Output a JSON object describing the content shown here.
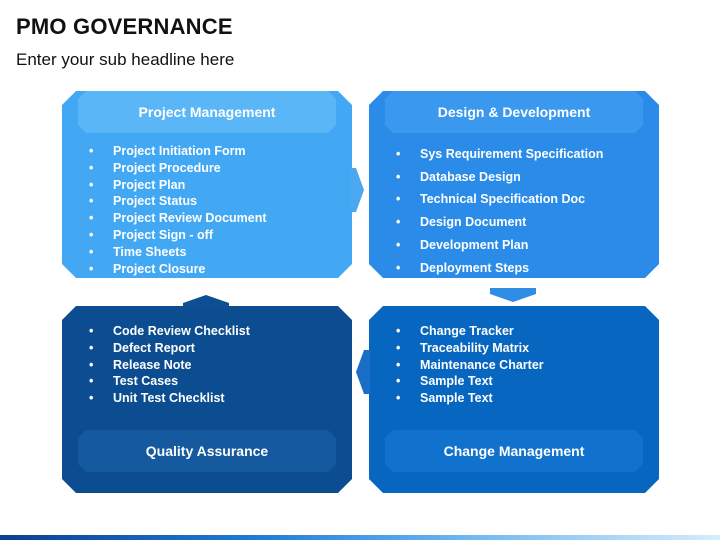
{
  "title": "PMO GOVERNANCE",
  "subtitle": "Enter your sub headline here",
  "quadrants": {
    "project_management": {
      "title": "Project Management",
      "items": [
        "Project Initiation Form",
        "Project Procedure",
        "Project Plan",
        "Project Status",
        "Project Review Document",
        "Project Sign - off",
        "Time Sheets",
        "Project Closure"
      ]
    },
    "design_development": {
      "title": "Design & Development",
      "items": [
        "Sys Requirement Specification",
        "Database Design",
        "Technical Specification Doc",
        "Design Document",
        "Development Plan",
        "Deployment Steps"
      ]
    },
    "quality_assurance": {
      "title": "Quality Assurance",
      "items": [
        "Code Review Checklist",
        "Defect Report",
        "Release Note",
        "Test Cases",
        "Unit Test Checklist"
      ]
    },
    "change_management": {
      "title": "Change Management",
      "items": [
        "Change Tracker",
        "Traceability Matrix",
        "Maintenance Charter",
        "Sample Text",
        "Sample Text"
      ]
    }
  },
  "colors": {
    "project_management": "#42a8f3",
    "design_development": "#2a8ce8",
    "quality_assurance": "#0b4d90",
    "change_management": "#0766c0"
  }
}
